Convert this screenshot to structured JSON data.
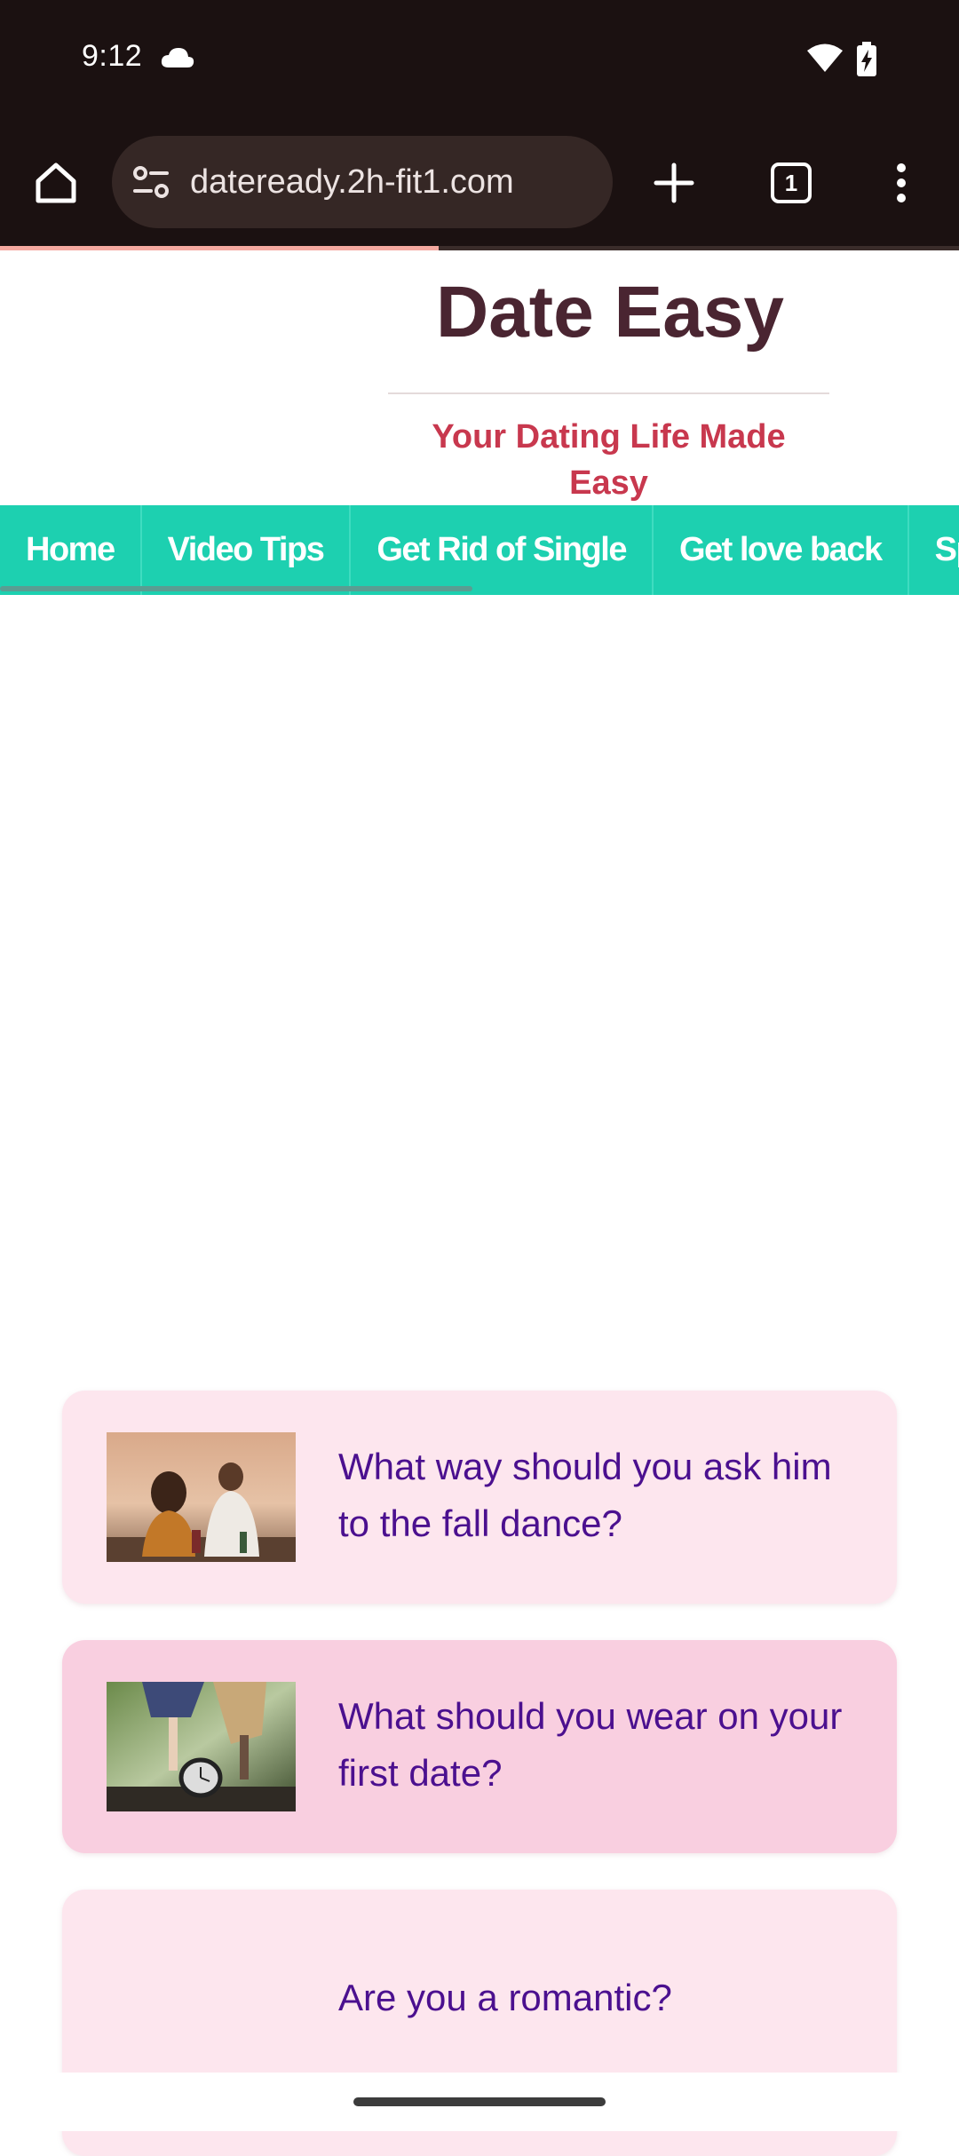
{
  "status_bar": {
    "time": "9:12",
    "icons": [
      "cloud-icon",
      "wifi-icon",
      "battery-charging-icon"
    ]
  },
  "browser": {
    "url": "dateready.2h-fit1.com",
    "tab_count": "1",
    "page_load_progress": 0.457,
    "icons": {
      "home": "home-icon",
      "site_info": "site-settings-icon",
      "new_tab": "plus-icon",
      "tabs": "tab-switcher-icon",
      "menu": "more-vert-icon"
    }
  },
  "site": {
    "title": "Date Easy",
    "tagline": "Your Dating Life Made Easy"
  },
  "nav": {
    "items": [
      "Home",
      "Video Tips",
      "Get Rid of Single",
      "Get love back",
      "Spark"
    ]
  },
  "articles": [
    {
      "title": "What way should you ask him to the fall dance?",
      "thumbnail": "couple-picnic-photo"
    },
    {
      "title": "What should you wear on your first date?",
      "thumbnail": "dancing-feet-clock-photo"
    },
    {
      "title": "Are you a romantic?",
      "thumbnail": ""
    }
  ],
  "colors": {
    "status_bg": "#1b1111",
    "url_pill": "#352725",
    "progress": "#f5a9a0",
    "title": "#4a2531",
    "tagline": "#c8384e",
    "nav_bg": "#1dd0b0",
    "card_light": "#fde6ee",
    "card_dark": "#f9cfe0",
    "article_text": "#4b108f"
  }
}
